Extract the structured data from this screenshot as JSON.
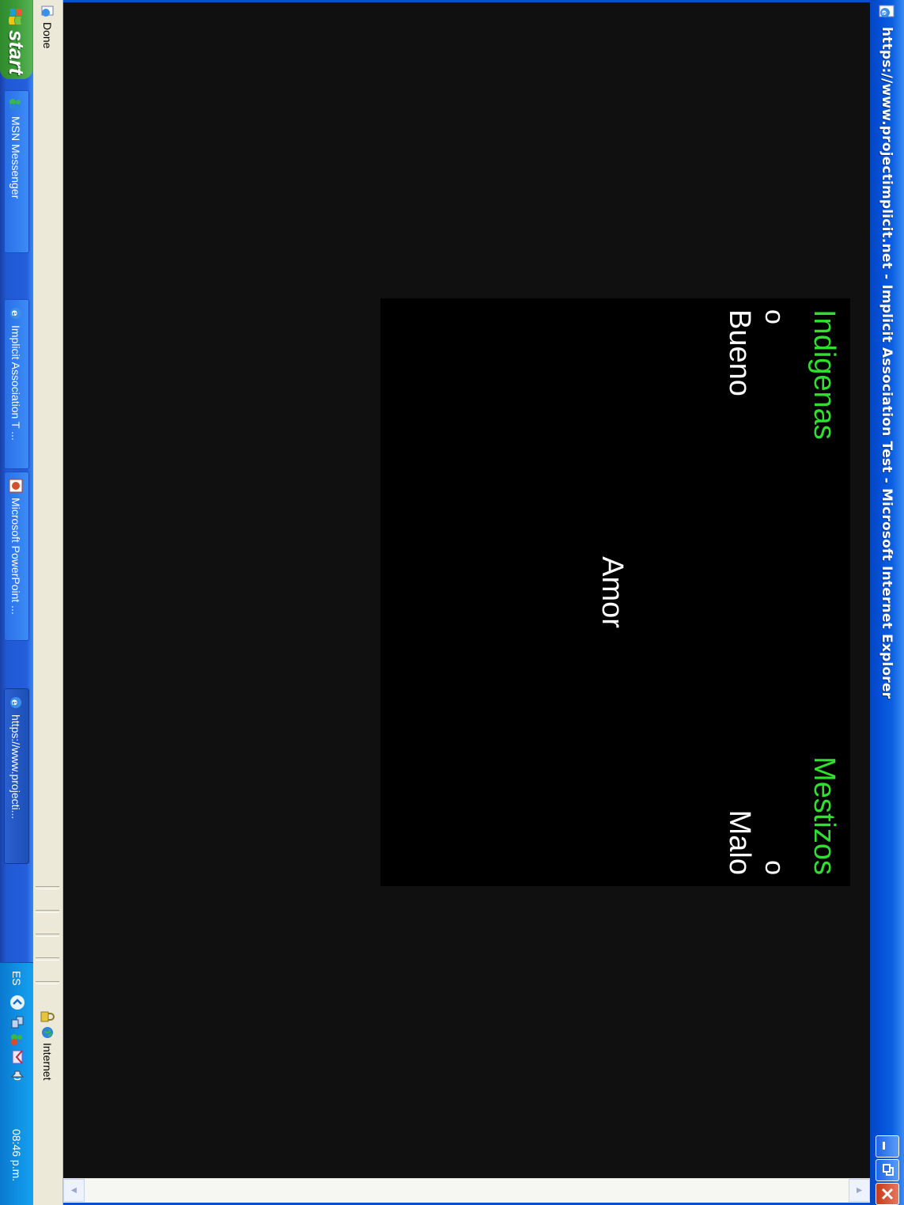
{
  "window": {
    "title": "https://www.projectimplicit.net - Implicit Association Test - Microsoft Internet Explorer",
    "controls": [
      "minimize",
      "restore",
      "close"
    ]
  },
  "iat": {
    "left_category": "Indigenas",
    "left_or": "o",
    "left_attribute": "Bueno",
    "right_category": "Mestizos",
    "right_or": "o",
    "right_attribute": "Malo",
    "stimulus": "Amor",
    "category_color": "#2fe02f",
    "text_color": "#ffffff",
    "background_color": "#000000"
  },
  "statusbar": {
    "status": "Done",
    "zone": "Internet"
  },
  "taskbar": {
    "start_label": "start",
    "tasks": [
      {
        "label": "MSN Messenger",
        "icon": "msn-icon"
      },
      {
        "label": "Implicit Association T ...",
        "icon": "ie-icon"
      },
      {
        "label": "Microsoft PowerPoint ...",
        "icon": "powerpoint-icon"
      },
      {
        "label": "https://www.projecti...",
        "icon": "ie-icon",
        "active": true
      }
    ],
    "tray": {
      "language": "ES",
      "clock": "08:46 p.m."
    }
  }
}
